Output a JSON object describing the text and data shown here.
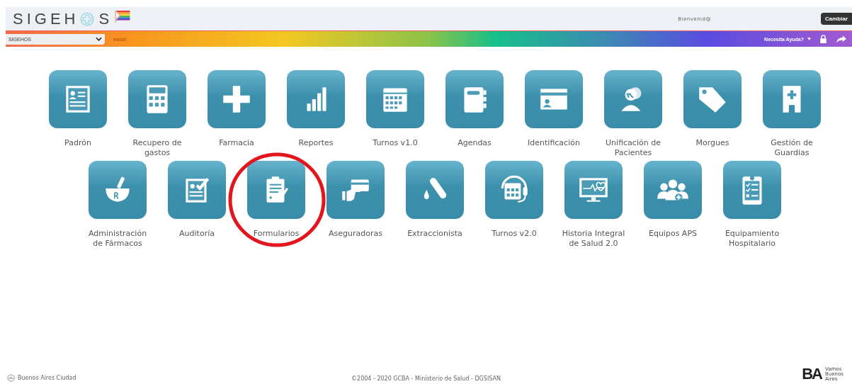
{
  "header": {
    "logo_start": "SIGEH",
    "logo_end": "S",
    "welcome": "Bienvenid@",
    "change_button": "Cambiar"
  },
  "navbar": {
    "system_select": "SIGEHOS",
    "home_link": "Inicio",
    "help_menu": "Necesita Ayuda?"
  },
  "module_rows": [
    {
      "items": [
        {
          "label": "Padrón",
          "circled": false
        },
        {
          "label": "Recupero de gastos",
          "circled": false
        },
        {
          "label": "Farmacia",
          "circled": false
        },
        {
          "label": "Reportes",
          "circled": false
        },
        {
          "label": "Turnos v1.0",
          "circled": false
        },
        {
          "label": "Agendas",
          "circled": false
        },
        {
          "label": "Identificación",
          "circled": false
        },
        {
          "label": "Unificación de Pacientes",
          "circled": false
        },
        {
          "label": "Morgues",
          "circled": false
        },
        {
          "label": "Gestión de Guardias",
          "circled": false
        }
      ]
    },
    {
      "items": [
        {
          "label": "Administración de Fármacos",
          "circled": false
        },
        {
          "label": "Auditoría",
          "circled": false
        },
        {
          "label": "Formularios",
          "circled": true
        },
        {
          "label": "Aseguradoras",
          "circled": false
        },
        {
          "label": "Extraccionista",
          "circled": false
        },
        {
          "label": "Turnos v2.0",
          "circled": false
        },
        {
          "label": "Historia Integral de Salud 2.0",
          "circled": false
        },
        {
          "label": "Equipos APS",
          "circled": false
        },
        {
          "label": "Equipamiento Hospitalario",
          "circled": false
        }
      ]
    }
  ],
  "footer": {
    "city": "Buenos Aires Ciudad",
    "copyright": "©2004 - 2020 GCBA - Ministerio de Salud - DGSISAN",
    "brand_mark": "BA",
    "brand_slogan": "Vamos Buenos Aires"
  }
}
